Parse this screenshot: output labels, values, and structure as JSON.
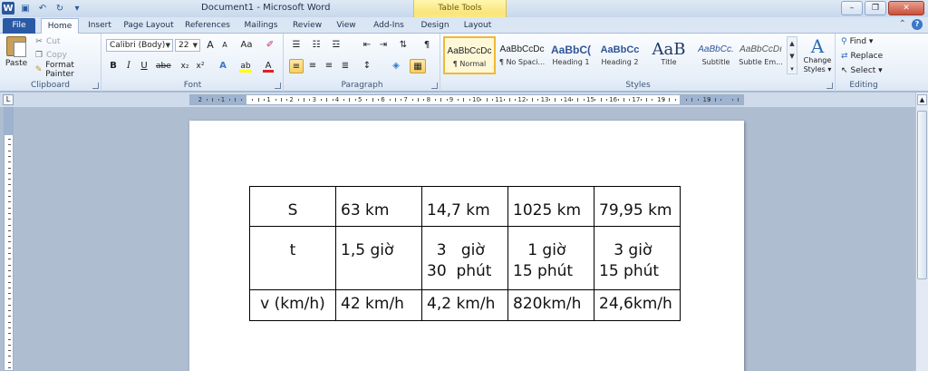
{
  "window": {
    "title": "Document1 - Microsoft Word",
    "context_tab_group": "Table Tools",
    "controls": [
      "–",
      "❐",
      "✕"
    ]
  },
  "tabs": [
    {
      "label": "File"
    },
    {
      "label": "Home"
    },
    {
      "label": "Insert"
    },
    {
      "label": "Page Layout"
    },
    {
      "label": "References"
    },
    {
      "label": "Mailings"
    },
    {
      "label": "Review"
    },
    {
      "label": "View"
    },
    {
      "label": "Add-Ins"
    },
    {
      "label": "Design"
    },
    {
      "label": "Layout"
    }
  ],
  "clipboard": {
    "group_label": "Clipboard",
    "paste": "Paste",
    "cut": "Cut",
    "copy": "Copy",
    "format_painter": "Format Painter"
  },
  "font": {
    "group_label": "Font",
    "font_name": "Calibri (Body)",
    "font_size": "22",
    "grow": "A",
    "shrink": "A",
    "case": "Aa",
    "bold": "B",
    "italic": "I",
    "underline": "U",
    "strike": "abe",
    "subscript": "x₂",
    "superscript": "x²",
    "text_effects": "A",
    "highlight": "ab",
    "font_color": "A",
    "highlight_color": "#ffff00",
    "font_color_value": "#e02020"
  },
  "paragraph": {
    "group_label": "Paragraph",
    "show_marks": "¶"
  },
  "styles": {
    "group_label": "Styles",
    "items": [
      {
        "preview": "AaBbCcDc",
        "name": "¶ Normal"
      },
      {
        "preview": "AaBbCcDc",
        "name": "¶ No Spaci..."
      },
      {
        "preview": "AaBbC(",
        "name": "Heading 1"
      },
      {
        "preview": "AaBbCc",
        "name": "Heading 2"
      },
      {
        "preview": "AaB",
        "name": "Title"
      },
      {
        "preview": "AaBbCc.",
        "name": "Subtitle"
      },
      {
        "preview": "AaBbCcDı",
        "name": "Subtle Em..."
      }
    ],
    "change_styles_line1": "Change",
    "change_styles_line2": "Styles ▾",
    "heading_color": "#2f5597"
  },
  "editing": {
    "group_label": "Editing",
    "find": "Find ▾",
    "replace": "Replace",
    "select": "Select ▾"
  },
  "ruler": {
    "numbers": [
      "2",
      "1",
      "1",
      "2",
      "3",
      "4",
      "5",
      "6",
      "7",
      "8",
      "9",
      "10",
      "11",
      "12",
      "13",
      "14",
      "15",
      "16",
      "17",
      "19",
      "19"
    ]
  },
  "table": {
    "rows": [
      [
        "S",
        "63 km",
        "14,7 km",
        "1025 km",
        "79,95 km"
      ],
      [
        "t",
        "1,5 giờ",
        "  3   giờ\n30  phút",
        "   1 giờ\n15 phút",
        "   3 giờ\n15 phút"
      ],
      [
        "v (km/h)",
        "42 km/h",
        "4,2 km/h",
        "820km/h",
        "24,6km/h"
      ]
    ]
  }
}
